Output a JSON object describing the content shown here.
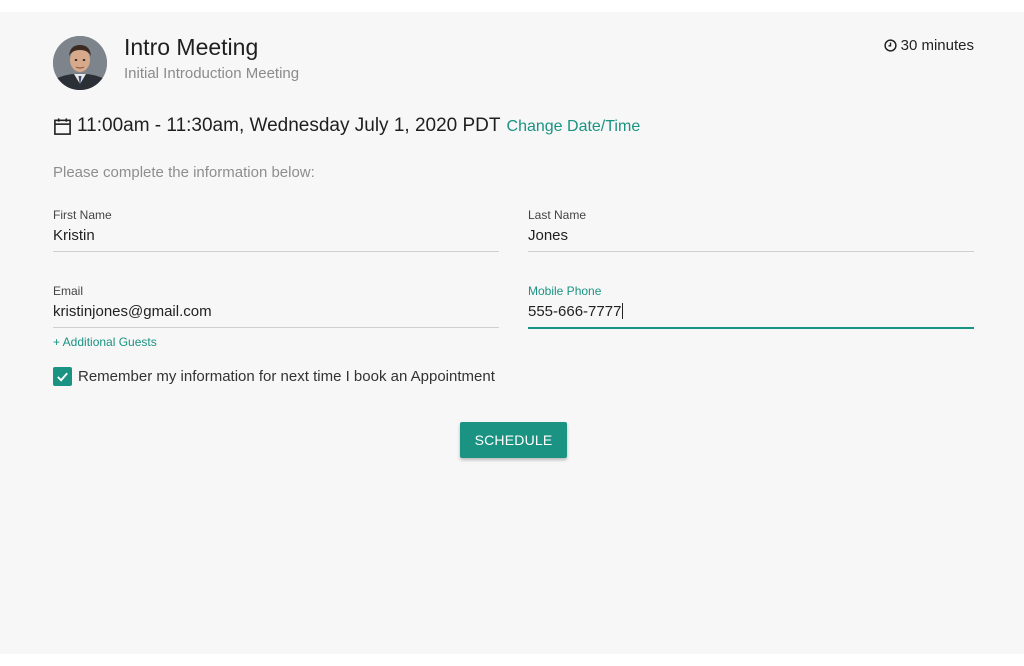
{
  "header": {
    "title": "Intro Meeting",
    "subtitle": "Initial Introduction Meeting",
    "duration": "30 minutes"
  },
  "datetime": {
    "text": "11:00am - 11:30am, Wednesday July 1, 2020 PDT",
    "change_link": "Change Date/Time"
  },
  "form": {
    "instructions": "Please complete the information below:",
    "first_name": {
      "label": "First Name",
      "value": "Kristin"
    },
    "last_name": {
      "label": "Last Name",
      "value": "Jones"
    },
    "email": {
      "label": "Email",
      "value": "kristinjones@gmail.com"
    },
    "mobile_phone": {
      "label": "Mobile Phone",
      "value": "555-666-7777"
    },
    "additional_guests": "+ Additional Guests",
    "remember": {
      "label": "Remember my information for next time I book an Appointment",
      "checked": true
    },
    "schedule_button": "SCHEDULE"
  },
  "colors": {
    "accent": "#1a9382",
    "background": "#f7f7f7"
  },
  "icons": {
    "duration": "clock-icon",
    "datetime": "calendar-icon",
    "checkbox": "check-icon"
  }
}
